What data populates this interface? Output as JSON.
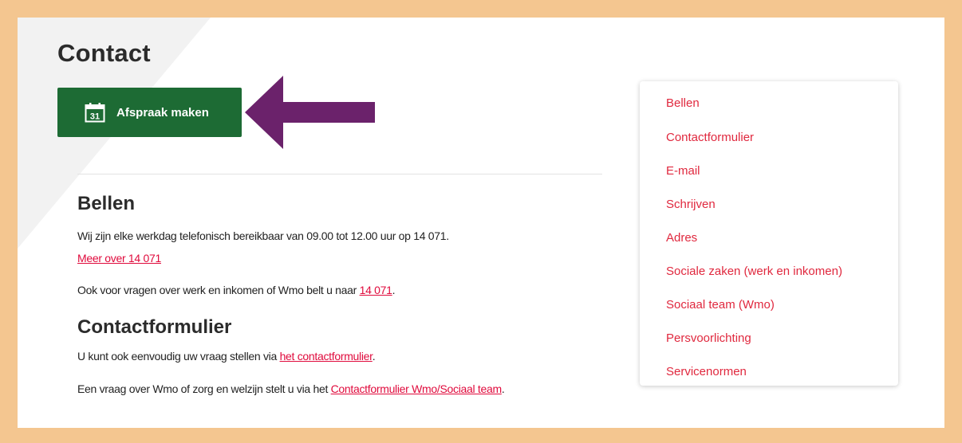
{
  "title": "Contact",
  "cta": {
    "label": "Afspraak maken",
    "icon": "calendar-icon",
    "icon_day": "31",
    "color": "#1d6b34"
  },
  "arrow_color": "#6b226b",
  "sections": {
    "bellen": {
      "heading": "Bellen",
      "line1": "Wij zijn elke werkdag telefonisch bereikbaar van 09.00 tot 12.00 uur op 14 071.",
      "link1": "Meer over 14 071",
      "line2_prefix": "Ook voor vragen over werk en inkomen of Wmo belt u naar ",
      "line2_link": "14 071",
      "line2_suffix": "."
    },
    "contactformulier": {
      "heading": "Contactformulier",
      "line1_prefix": "U kunt ook eenvoudig uw vraag stellen via ",
      "line1_link": "het contactformulier",
      "line1_suffix": ".",
      "line2_prefix": "Een vraag over Wmo of zorg en welzijn stelt u via het ",
      "line2_link": "Contactformulier Wmo/Sociaal team",
      "line2_suffix": "."
    }
  },
  "sidebar": {
    "items": [
      "Bellen",
      "Contactformulier",
      "E-mail",
      "Schrijven",
      "Adres",
      "Sociale zaken (werk en inkomen)",
      "Sociaal team (Wmo)",
      "Persvoorlichting",
      "Servicenormen"
    ]
  },
  "colors": {
    "border": "#f4c690",
    "link": "#e00a3c",
    "sidebar_link": "#e0283e"
  }
}
